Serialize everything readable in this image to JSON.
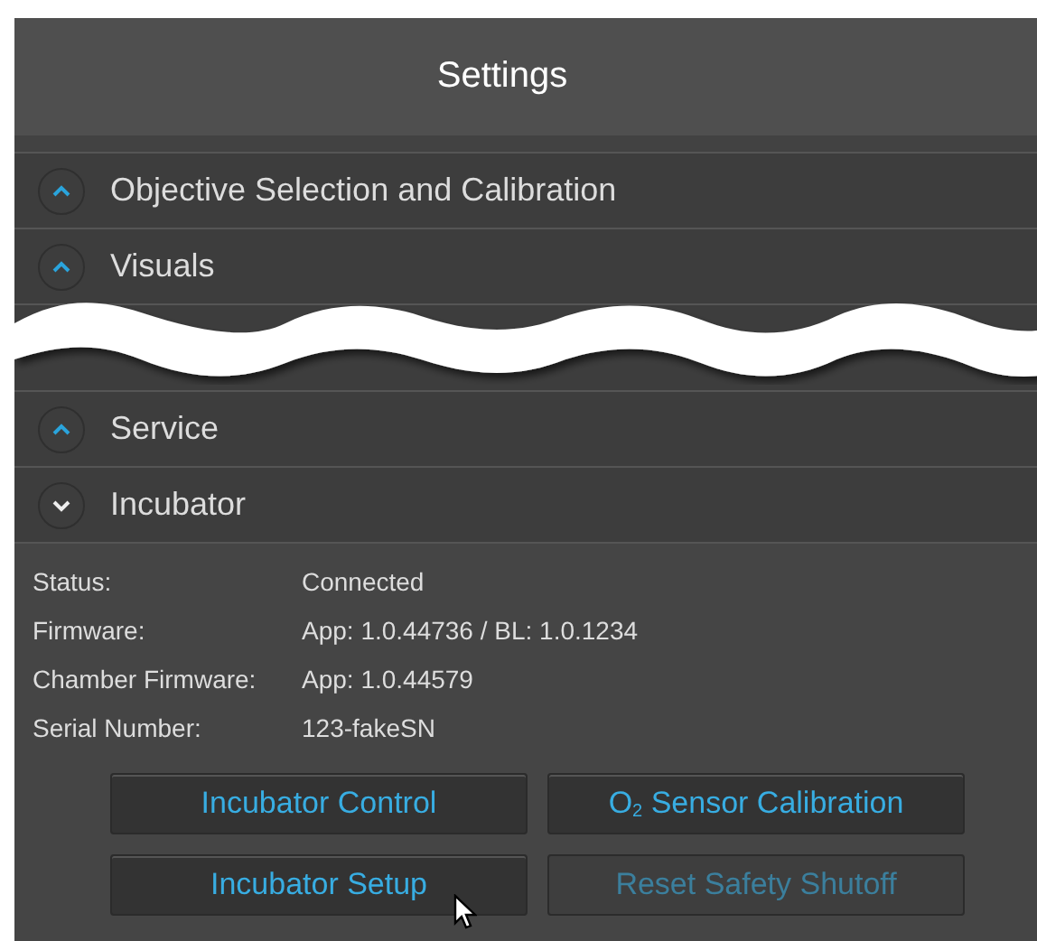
{
  "window": {
    "title": "Settings"
  },
  "sections": [
    {
      "label": "Objective Selection and Calibration",
      "expanded": false
    },
    {
      "label": "Visuals",
      "expanded": false
    },
    {
      "kind": "break"
    },
    {
      "label": "Service",
      "expanded": false
    },
    {
      "label": "Incubator",
      "expanded": true
    }
  ],
  "incubator": {
    "fields": [
      {
        "label": "Status:",
        "value": "Connected"
      },
      {
        "label": "Firmware:",
        "value": "App: 1.0.44736 / BL: 1.0.1234"
      },
      {
        "label": "Chamber Firmware:",
        "value": "App: 1.0.44579"
      },
      {
        "label": "Serial Number:",
        "value": "123-fakeSN"
      }
    ],
    "buttons": [
      {
        "label": "Incubator Control",
        "disabled": false
      },
      {
        "label": "O$_{2}$ Sensor Calibration",
        "disabled": false
      },
      {
        "label": "Incubator Setup",
        "disabled": false,
        "hovered": true
      },
      {
        "label": "Reset Safety Shutoff",
        "disabled": true
      }
    ]
  }
}
